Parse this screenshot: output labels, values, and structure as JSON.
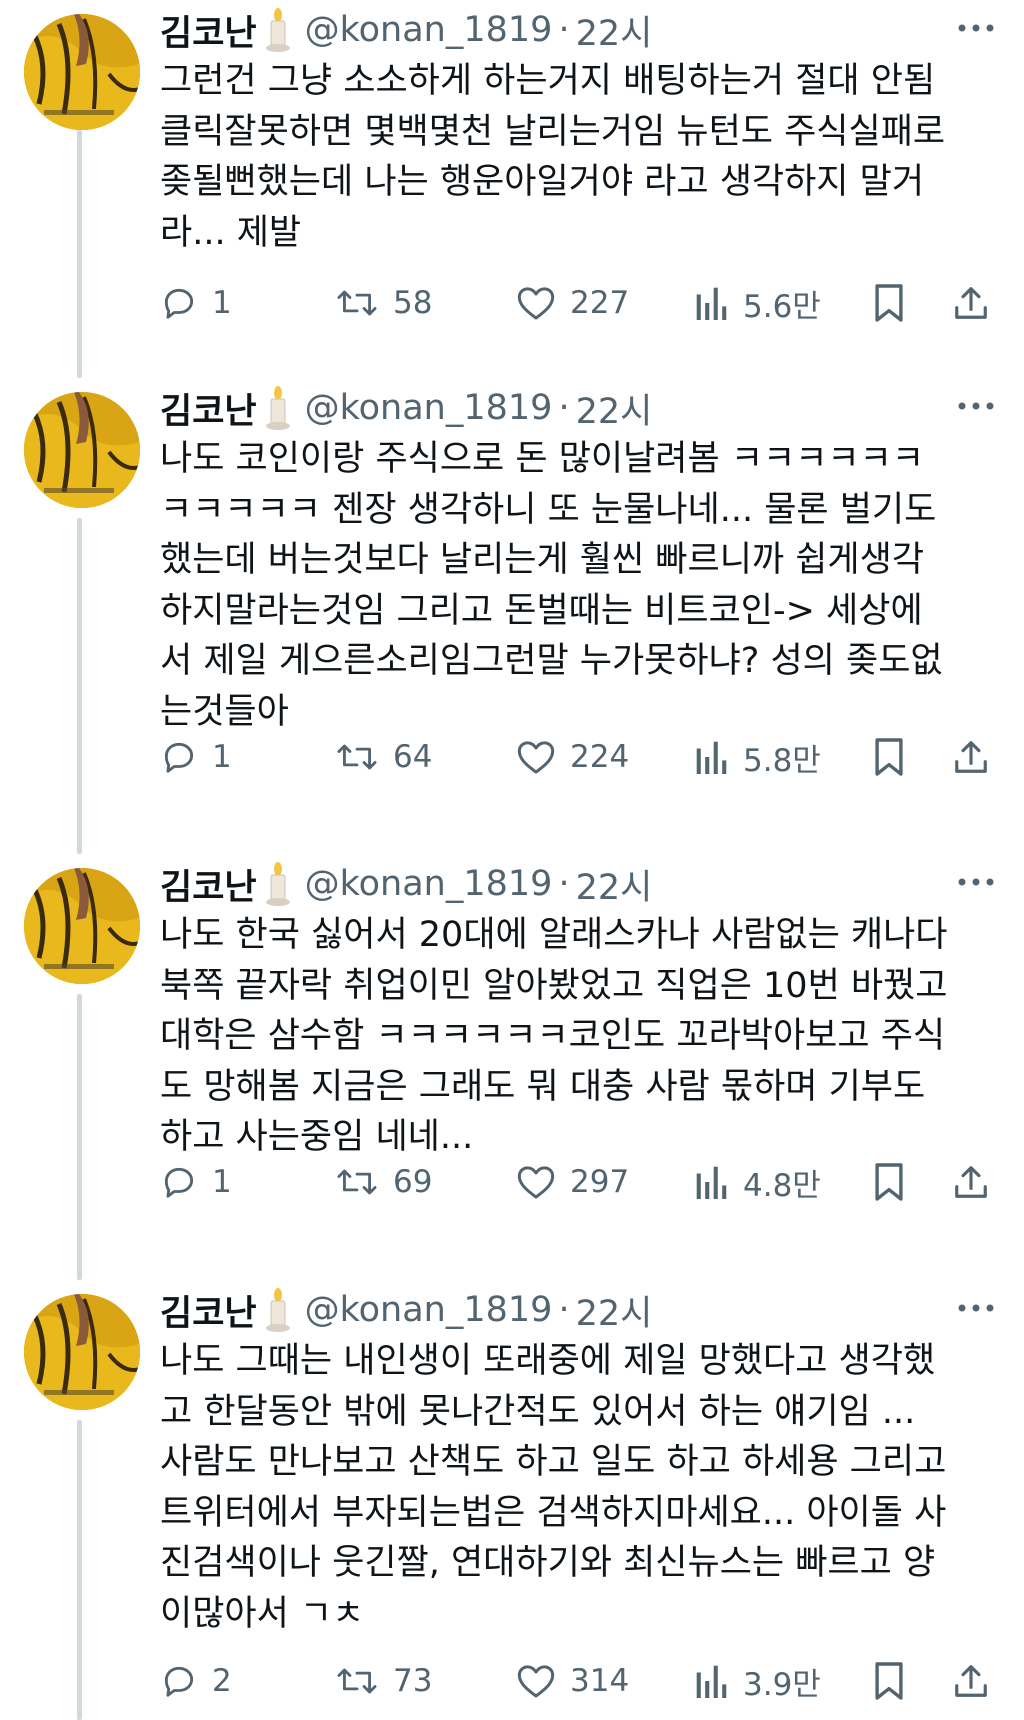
{
  "colors": {
    "text": "#0f1419",
    "muted": "#536471",
    "thread_line": "#cfd9de",
    "avatar_bg": "#d9a514"
  },
  "icons": {
    "reply": "speech-bubble-icon",
    "retweet": "retweet-arrows-icon",
    "like": "heart-icon",
    "views": "bar-chart-icon",
    "bookmark": "bookmark-icon",
    "share": "share-upload-icon",
    "more": "more-dots-icon",
    "badge": "candle-emoji-icon"
  },
  "tweets": [
    {
      "name": "김코난",
      "handle": "@konan_1819",
      "separator": "·",
      "time": "22시",
      "lines": [
        "그런건 그냥 소소하게 하는거지 배팅하는거 절대 안됨",
        "클릭잘못하면 몇백몇천 날리는거임 뉴턴도 주식실패로",
        "좆될뻔했는데 나는 행운아일거야 라고 생각하지 말거",
        "라... 제발"
      ],
      "replies": "1",
      "retweets": "58",
      "likes": "227",
      "views": "5.6만"
    },
    {
      "name": "김코난",
      "handle": "@konan_1819",
      "separator": "·",
      "time": "22시",
      "lines": [
        "나도 코인이랑 주식으로 돈 많이날려봄 ㅋㅋㅋㅋㅋㅋ",
        "ㅋㅋㅋㅋㅋ 젠장 생각하니 또 눈물나네... 물론 벌기도",
        "했는데 버는것보다 날리는게 훨씬 빠르니까 쉽게생각",
        "하지말라는것임 그리고 돈벌때는 비트코인-> 세상에",
        "서 제일 게으른소리임그런말 누가못하냐? 성의 좆도없",
        "는것들아"
      ],
      "replies": "1",
      "retweets": "64",
      "likes": "224",
      "views": "5.8만"
    },
    {
      "name": "김코난",
      "handle": "@konan_1819",
      "separator": "·",
      "time": "22시",
      "lines": [
        "나도 한국 싫어서 20대에 알래스카나 사람없는 캐나다",
        "북쪽 끝자락 취업이민 알아봤었고 직업은 10번 바꿨고",
        "대학은 삼수함 ㅋㅋㅋㅋㅋㅋ코인도 꼬라박아보고 주식",
        "도 망해봄  지금은 그래도 뭐 대충 사람 몫하며 기부도",
        "하고 사는중임 네네..."
      ],
      "replies": "1",
      "retweets": "69",
      "likes": "297",
      "views": "4.8만"
    },
    {
      "name": "김코난",
      "handle": "@konan_1819",
      "separator": "·",
      "time": "22시",
      "lines": [
        "나도 그때는 내인생이 또래중에 제일 망했다고 생각했",
        "고 한달동안 밖에 못나간적도 있어서 하는 얘기임 ...",
        "사람도 만나보고 산책도 하고 일도 하고 하세용 그리고",
        "트위터에서 부자되는법은 검색하지마세요... 아이돌 사",
        "진검색이나 웃긴짤, 연대하기와 최신뉴스는 빠르고 양",
        "이많아서 ㄱㅊ"
      ],
      "replies": "2",
      "retweets": "73",
      "likes": "314",
      "views": "3.9만"
    }
  ]
}
